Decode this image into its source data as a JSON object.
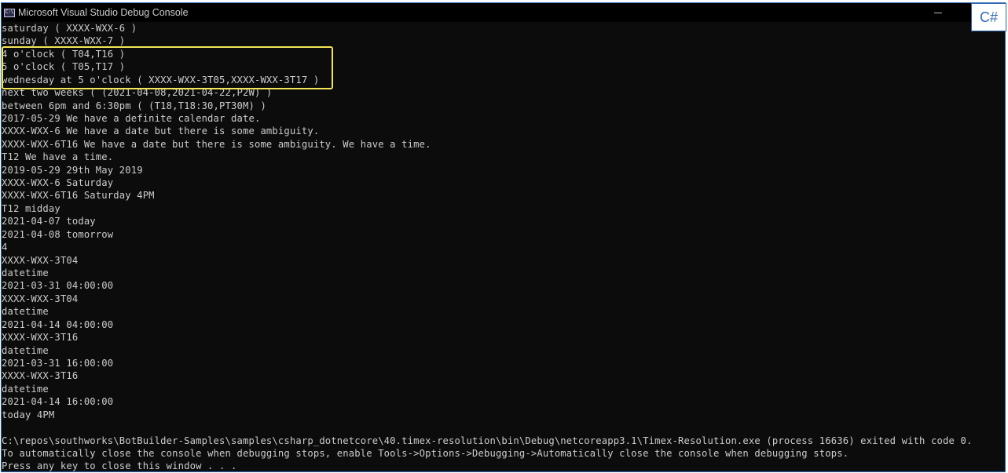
{
  "window": {
    "title": "Microsoft Visual Studio Debug Console",
    "icon": "console-app-icon",
    "icon_text": "C:\\"
  },
  "badge": {
    "label": "C#"
  },
  "console": {
    "lines": [
      "saturday ( XXXX-WXX-6 )",
      "sunday ( XXXX-WXX-7 )",
      "4 o'clock ( T04,T16 )",
      "5 o'clock ( T05,T17 )",
      "wednesday at 5 o'clock ( XXXX-WXX-3T05,XXXX-WXX-3T17 )",
      "next two weeks ( (2021-04-08,2021-04-22,P2W) )",
      "between 6pm and 6:30pm ( (T18,T18:30,PT30M) )",
      "2017-05-29 We have a definite calendar date.",
      "XXXX-WXX-6 We have a date but there is some ambiguity.",
      "XXXX-WXX-6T16 We have a date but there is some ambiguity. We have a time.",
      "T12 We have a time.",
      "2019-05-29 29th May 2019",
      "XXXX-WXX-6 Saturday",
      "XXXX-WXX-6T16 Saturday 4PM",
      "T12 midday",
      "2021-04-07 today",
      "2021-04-08 tomorrow",
      "4",
      "XXXX-WXX-3T04",
      "datetime",
      "2021-03-31 04:00:00",
      "XXXX-WXX-3T04",
      "datetime",
      "2021-04-14 04:00:00",
      "XXXX-WXX-3T16",
      "datetime",
      "2021-03-31 16:00:00",
      "XXXX-WXX-3T16",
      "datetime",
      "2021-04-14 16:00:00",
      "today 4PM",
      "",
      "C:\\repos\\southworks\\BotBuilder-Samples\\samples\\csharp_dotnetcore\\40.timex-resolution\\bin\\Debug\\netcoreapp3.1\\Timex-Resolution.exe (process 16636) exited with code 0.",
      "To automatically close the console when debugging stops, enable Tools->Options->Debugging->Automatically close the console when debugging stops.",
      "Press any key to close this window . . ."
    ]
  },
  "colors": {
    "console_bg": "#0c0c0c",
    "console_text": "#cccccc",
    "highlight": "#f2e55a",
    "accent": "#2f6bb5"
  }
}
